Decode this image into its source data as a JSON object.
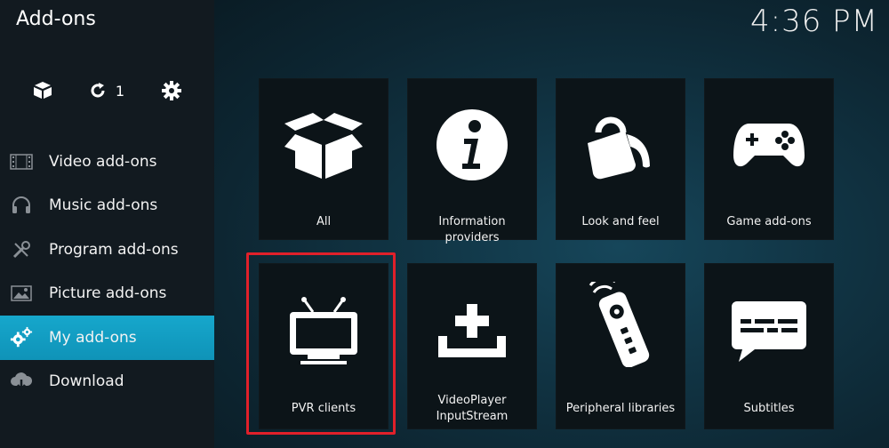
{
  "header": {
    "title": "Add-ons",
    "clock": "4:36 PM"
  },
  "toolbar": {
    "install_icon": "box-icon",
    "update_icon": "refresh-icon",
    "update_count": "1",
    "settings_icon": "gear-icon"
  },
  "sidebar": {
    "items": [
      {
        "label": "Video add-ons",
        "icon": "film-icon"
      },
      {
        "label": "Music add-ons",
        "icon": "headphones-icon"
      },
      {
        "label": "Program add-ons",
        "icon": "tools-icon"
      },
      {
        "label": "Picture add-ons",
        "icon": "picture-icon"
      },
      {
        "label": "My add-ons",
        "icon": "gears-icon",
        "active": true
      },
      {
        "label": "Download",
        "icon": "cloud-download-icon"
      }
    ]
  },
  "tiles": [
    {
      "label": "All",
      "icon": "open-box-icon"
    },
    {
      "label": "Information providers",
      "icon": "info-icon"
    },
    {
      "label": "Look and feel",
      "icon": "paint-bucket-icon"
    },
    {
      "label": "Game add-ons",
      "icon": "gamepad-icon"
    },
    {
      "label": "PVR clients",
      "icon": "tv-icon",
      "highlighted": true
    },
    {
      "label_line1": "VideoPlayer",
      "label_line2": "InputStream",
      "icon": "input-tray-icon"
    },
    {
      "label": "Peripheral libraries",
      "icon": "remote-icon"
    },
    {
      "label": "Subtitles",
      "icon": "subtitles-icon"
    }
  ],
  "colors": {
    "accent": "#12a0c6",
    "highlight_border": "#e0202a",
    "tile_bg": "#0c1418",
    "sidebar_bg": "#121a20"
  }
}
